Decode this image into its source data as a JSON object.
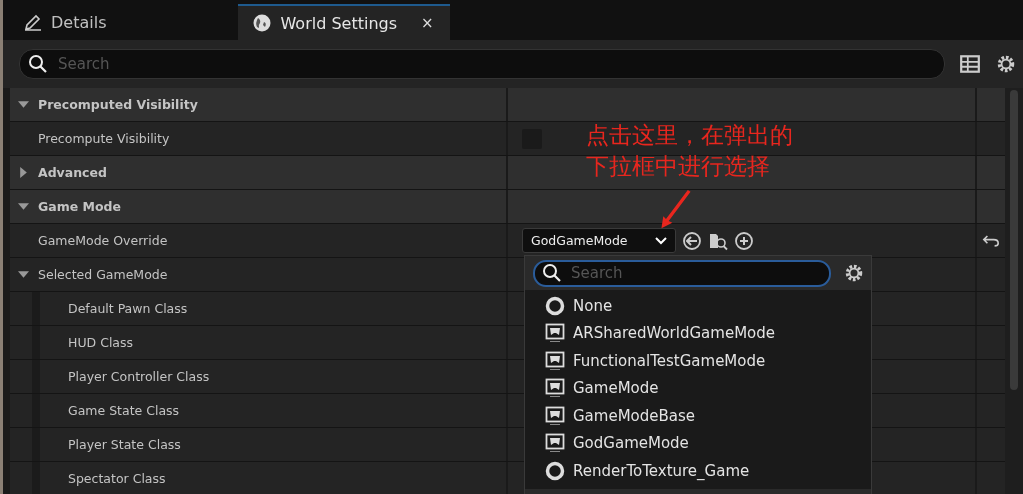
{
  "tabs": [
    {
      "label": "Details",
      "kind": "document",
      "selected": false
    },
    {
      "label": "World Settings",
      "kind": "world",
      "selected": true,
      "close": "×"
    }
  ],
  "search": {
    "placeholder": "Search"
  },
  "rows": [
    {
      "kind": "category",
      "label": "Precomputed Visibility",
      "expanded": true
    },
    {
      "kind": "checkbox",
      "label": "Precompute Visibility",
      "checked": false
    },
    {
      "kind": "category",
      "label": "Advanced",
      "expanded": false
    },
    {
      "kind": "category",
      "label": "Game Mode",
      "expanded": true
    },
    {
      "kind": "combo",
      "label": "GameMode Override",
      "value": "GodGameMode",
      "reset": true
    },
    {
      "kind": "group",
      "label": "Selected GameMode",
      "expanded": true,
      "children": [
        {
          "label": "Default Pawn Class"
        },
        {
          "label": "HUD Class"
        },
        {
          "label": "Player Controller Class"
        },
        {
          "label": "Game State Class"
        },
        {
          "label": "Player State Class"
        },
        {
          "label": "Spectator Class"
        }
      ]
    }
  ],
  "dropdown": {
    "search_placeholder": "Search",
    "items": [
      {
        "label": "None",
        "kind": "none"
      },
      {
        "label": "ARSharedWorldGameMode",
        "kind": "class"
      },
      {
        "label": "FunctionalTestGameMode",
        "kind": "class"
      },
      {
        "label": "GameMode",
        "kind": "class"
      },
      {
        "label": "GameModeBase",
        "kind": "class"
      },
      {
        "label": "GodGameMode",
        "kind": "class"
      },
      {
        "label": "RenderToTexture_Game",
        "kind": "none"
      }
    ]
  },
  "annotation": {
    "lines": [
      "点击这里，在弹出的",
      "下拉框中进行选择"
    ]
  }
}
